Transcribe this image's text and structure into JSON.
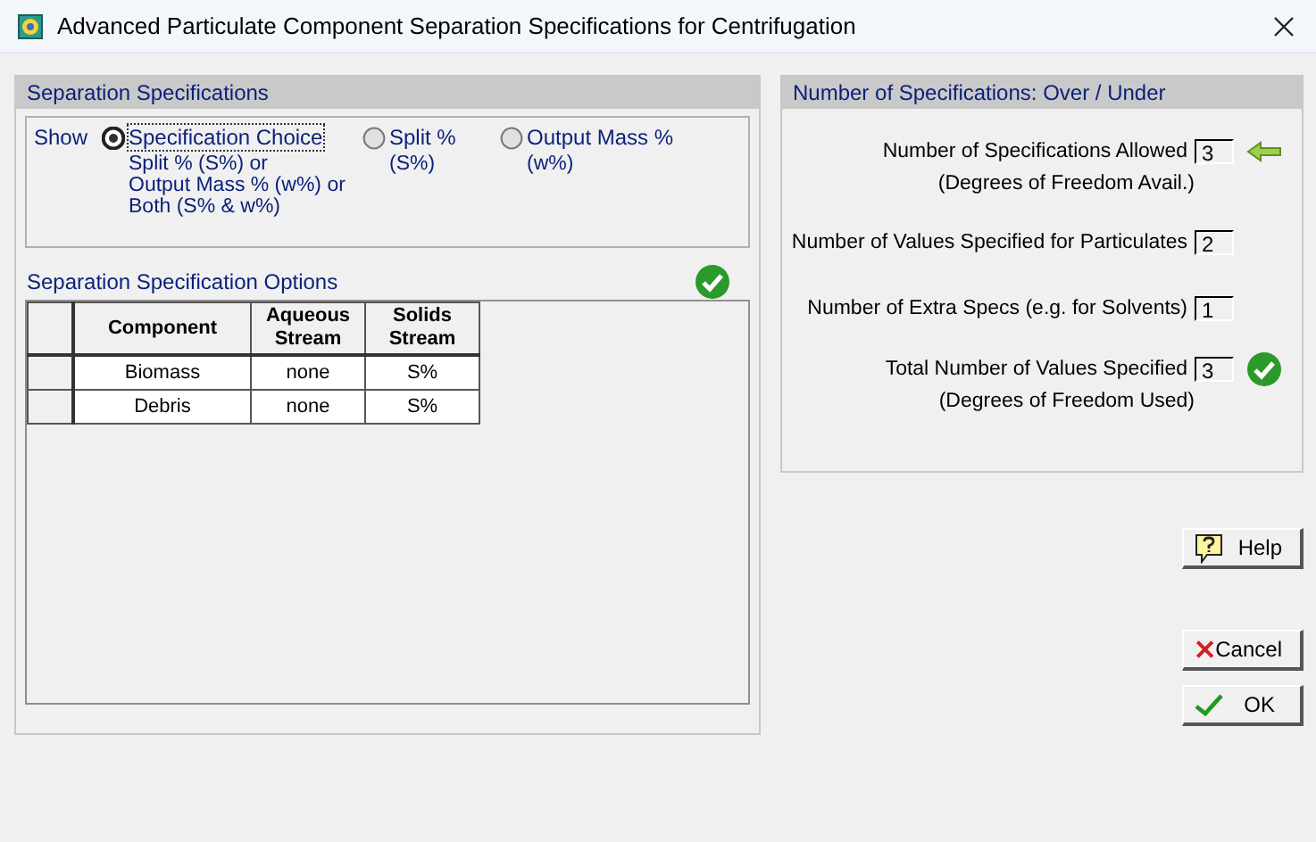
{
  "window": {
    "title": "Advanced Particulate Component Separation Specifications for Centrifugation"
  },
  "separation": {
    "title": "Separation Specifications",
    "show_label": "Show",
    "options": [
      {
        "label": "Specification Choice",
        "description": [
          "Split % (S%)  or",
          "Output Mass % (w%)  or",
          "Both (S% & w%)"
        ],
        "selected": true
      },
      {
        "label": "Split %",
        "description": [
          "(S%)"
        ],
        "selected": false
      },
      {
        "label": "Output Mass %",
        "description": [
          "(w%)"
        ],
        "selected": false
      }
    ],
    "options_title": "Separation Specification Options",
    "table": {
      "columns": [
        "Component",
        "Aqueous Stream",
        "Solids Stream"
      ],
      "rows": [
        [
          "Biomass",
          "none",
          "S%"
        ],
        [
          "Debris",
          "none",
          "S%"
        ]
      ]
    }
  },
  "counts": {
    "title": "Number of Specifications: Over / Under",
    "rows": [
      {
        "label": "Number of Specifications Allowed",
        "sublabel": "(Degrees of Freedom Avail.)",
        "value": "3",
        "kind": "arrow"
      },
      {
        "label": "Number of Values Specified for Particulates",
        "value": "2",
        "kind": "plain"
      },
      {
        "label": "Number of Extra Specs (e.g. for Solvents)",
        "value": "1",
        "kind": "plain"
      },
      {
        "label": "Total Number of Values Specified",
        "sublabel": "(Degrees of Freedom Used)",
        "value": "3",
        "kind": "check"
      }
    ]
  },
  "buttons": [
    {
      "label": "Help",
      "kind": "help"
    },
    {
      "label": "Cancel",
      "kind": "cancel"
    },
    {
      "label": "OK",
      "kind": "ok"
    }
  ]
}
